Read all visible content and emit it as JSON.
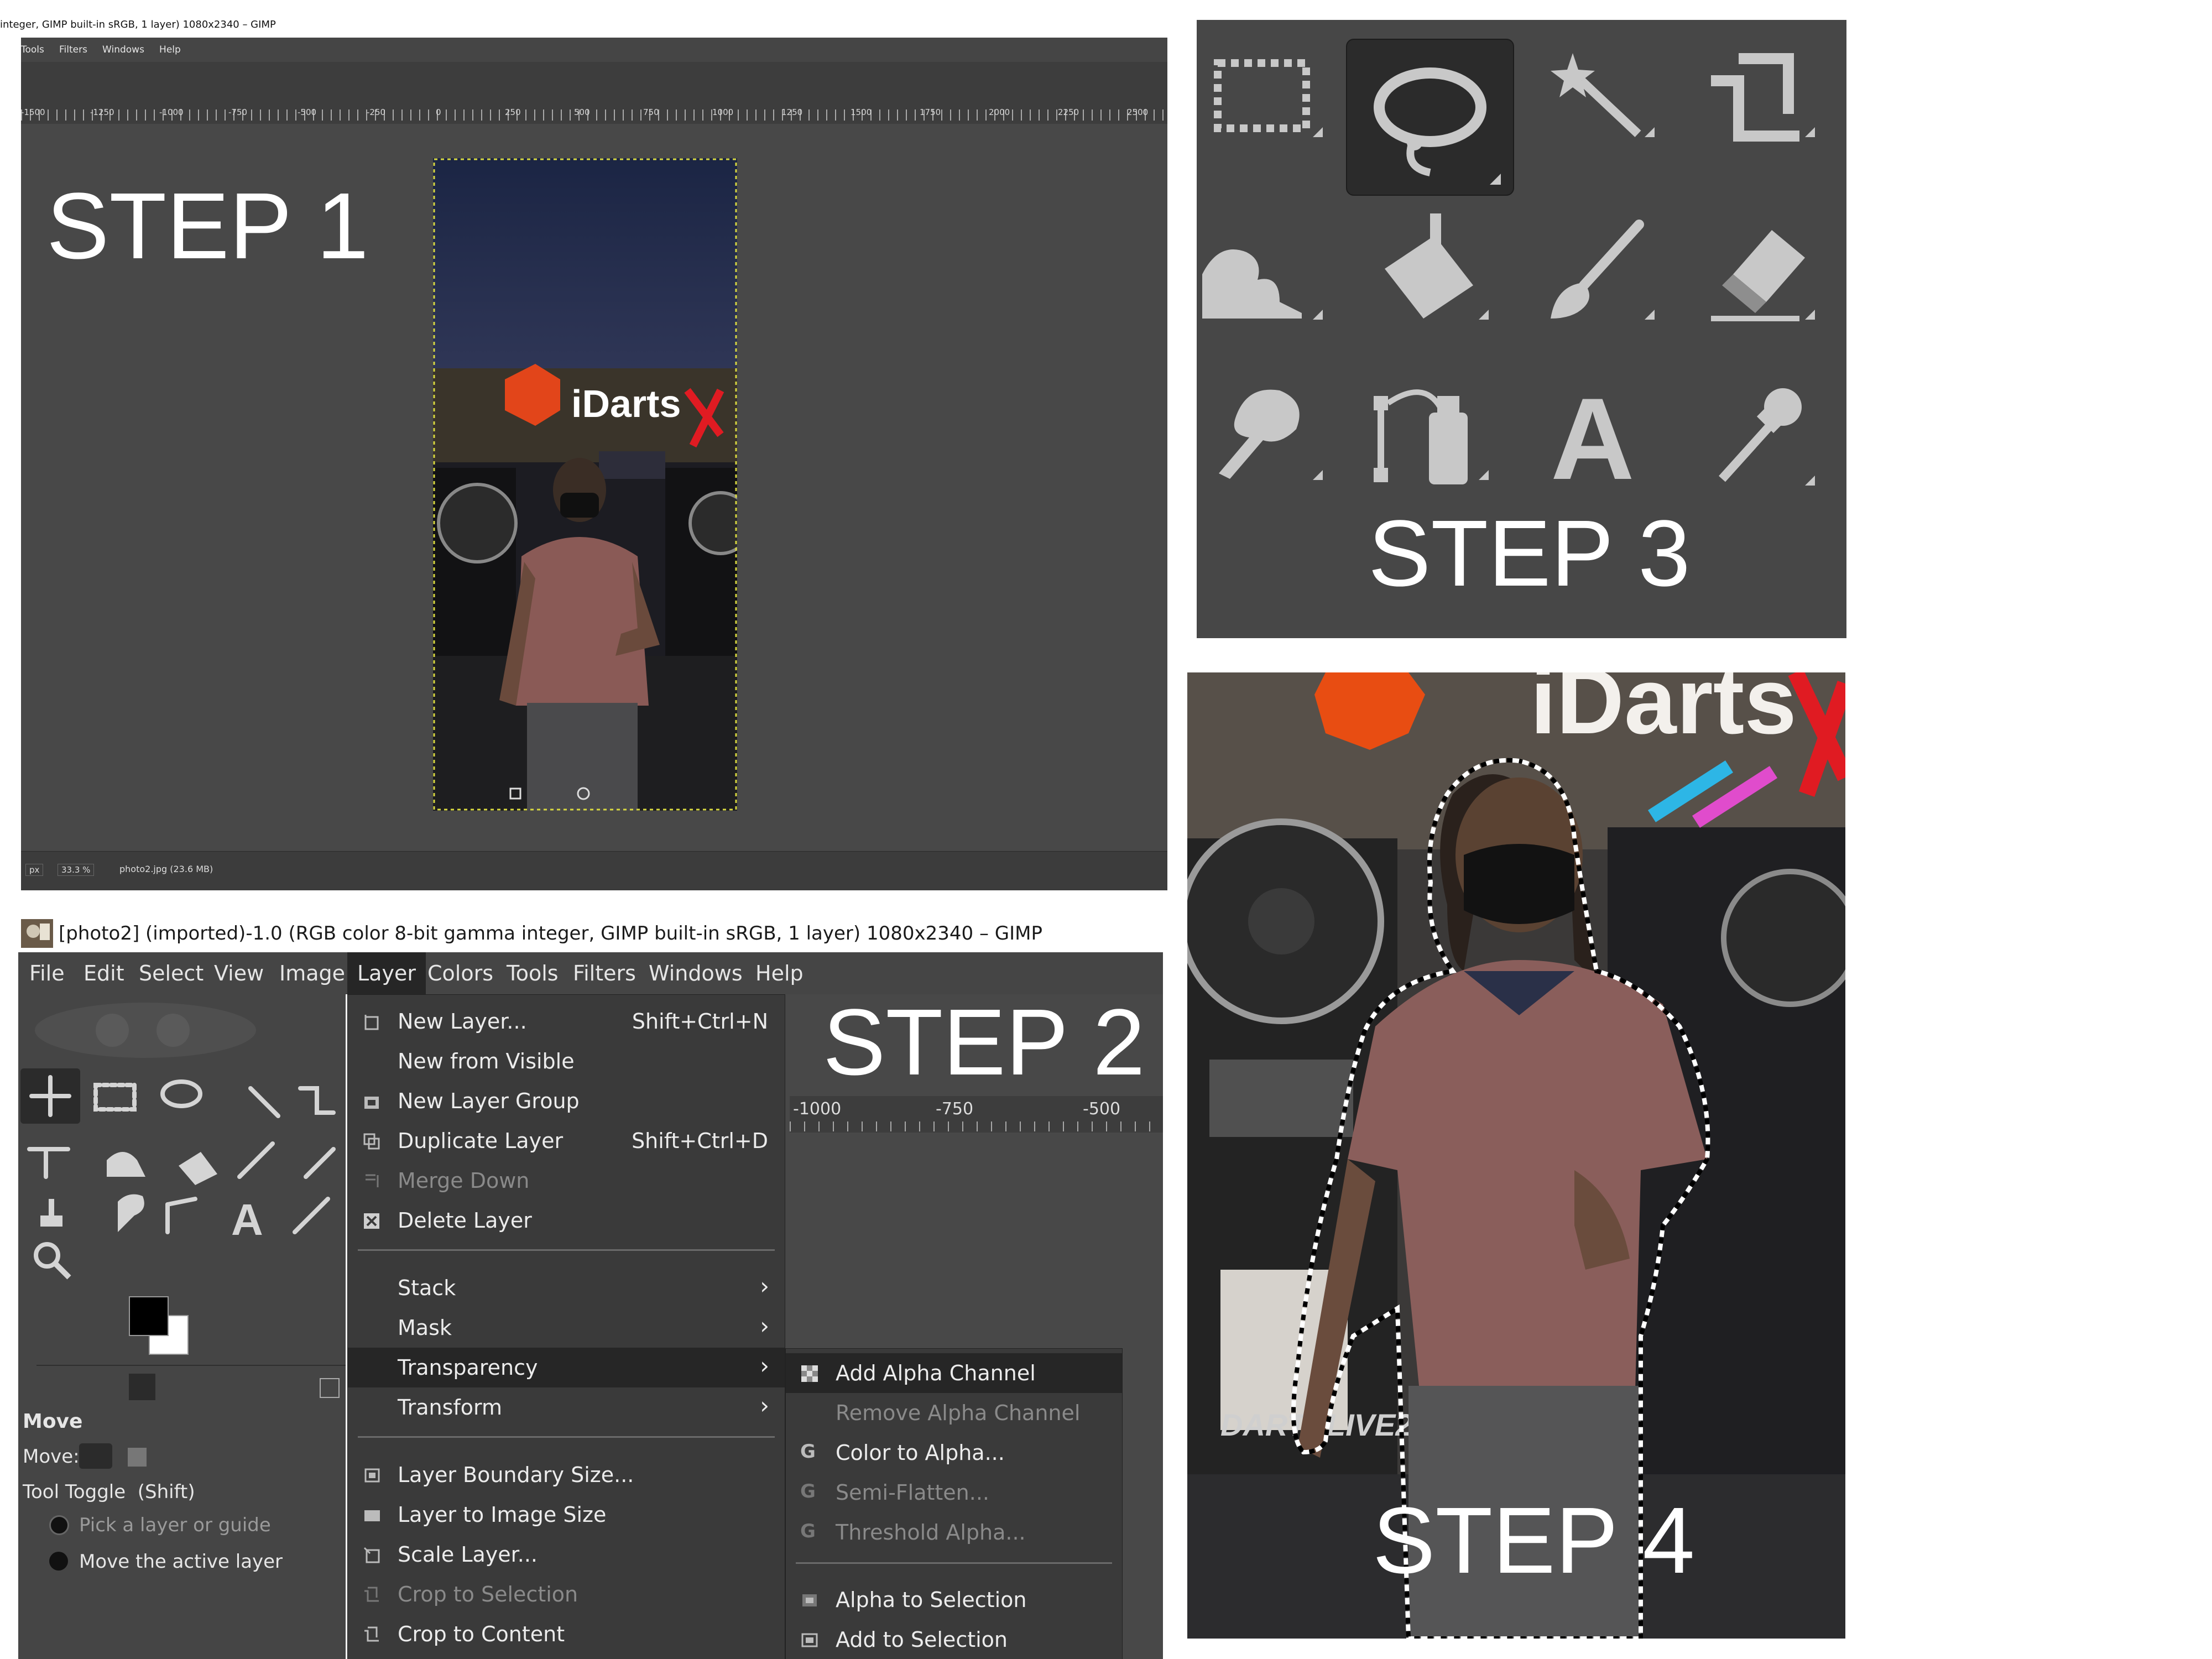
{
  "step_labels": {
    "s1": "STEP 1",
    "s2": "STEP 2",
    "s3": "STEP 3",
    "s4": "STEP 4"
  },
  "panel1": {
    "title": "integer, GIMP built-in sRGB, 1 layer) 1080x2340 – GIMP",
    "menu": [
      "Tools",
      "Filters",
      "Windows",
      "Help"
    ],
    "ruler_labels": [
      "-1500",
      "-1250",
      "-1000",
      "-750",
      "-500",
      "-250",
      "0",
      "250",
      "500",
      "750",
      "1000",
      "1250",
      "1500",
      "1750",
      "2000",
      "2250",
      "2500"
    ],
    "status": {
      "unit": "px",
      "zoom": "33.3 %",
      "file": "photo2.jpg (23.6 MB)"
    },
    "photo_sign": "iDarts"
  },
  "panel2": {
    "title": "[photo2] (imported)-1.0 (RGB color 8-bit gamma integer, GIMP built-in sRGB, 1 layer) 1080x2340 – GIMP",
    "menu": [
      "File",
      "Edit",
      "Select",
      "View",
      "Image",
      "Layer",
      "Colors",
      "Tools",
      "Filters",
      "Windows",
      "Help"
    ],
    "active_menu": "Layer",
    "layer_menu": [
      {
        "label": "New Layer...",
        "shortcut": "Shift+Ctrl+N",
        "disabled": false
      },
      {
        "label": "New from Visible",
        "shortcut": "",
        "disabled": false
      },
      {
        "label": "New Layer Group",
        "shortcut": "",
        "disabled": false
      },
      {
        "label": "Duplicate Layer",
        "shortcut": "Shift+Ctrl+D",
        "disabled": false
      },
      {
        "label": "Merge Down",
        "shortcut": "",
        "disabled": true
      },
      {
        "label": "Delete Layer",
        "shortcut": "",
        "disabled": false
      },
      {
        "label": "Stack",
        "submenu": true
      },
      {
        "label": "Mask",
        "submenu": true
      },
      {
        "label": "Transparency",
        "submenu": true,
        "highlighted": true
      },
      {
        "label": "Transform",
        "submenu": true
      },
      {
        "label": "Layer Boundary Size...",
        "disabled": false
      },
      {
        "label": "Layer to Image Size",
        "disabled": false
      },
      {
        "label": "Scale Layer...",
        "disabled": false
      },
      {
        "label": "Crop to Selection",
        "disabled": true
      },
      {
        "label": "Crop to Content",
        "disabled": false
      }
    ],
    "transparency_submenu": [
      {
        "label": "Add Alpha Channel",
        "highlighted": true
      },
      {
        "label": "Remove Alpha Channel",
        "disabled": true
      },
      {
        "label": "Color to Alpha...",
        "disabled": false
      },
      {
        "label": "Semi-Flatten...",
        "disabled": true
      },
      {
        "label": "Threshold Alpha...",
        "disabled": true
      },
      {
        "label": "Alpha to Selection",
        "disabled": false
      },
      {
        "label": "Add to Selection",
        "disabled": false
      }
    ],
    "ruler_labels": [
      "-1000",
      "-750",
      "-500"
    ],
    "tool_options": {
      "title": "Move",
      "move_label": "Move:",
      "toggle": "Tool Toggle  (Shift)",
      "option1": "Pick a layer or guide",
      "option2": "Move the active layer"
    }
  },
  "panel3": {
    "tools": [
      "rect-select",
      "free-select",
      "fuzzy-select",
      "crop",
      "warp-transform",
      "bucket-fill",
      "paintbrush",
      "eraser",
      "smudge",
      "paths",
      "text",
      "color-picker"
    ],
    "active_tool": "free-select"
  },
  "panel4": {
    "photo_sign": "iDarts",
    "machine_text": "DARTSLIVE2"
  },
  "colors": {
    "gimp_dark": "#454545",
    "menu_bg": "#3a3a3a",
    "highlight": "#262626",
    "selection": "#ffffff"
  }
}
